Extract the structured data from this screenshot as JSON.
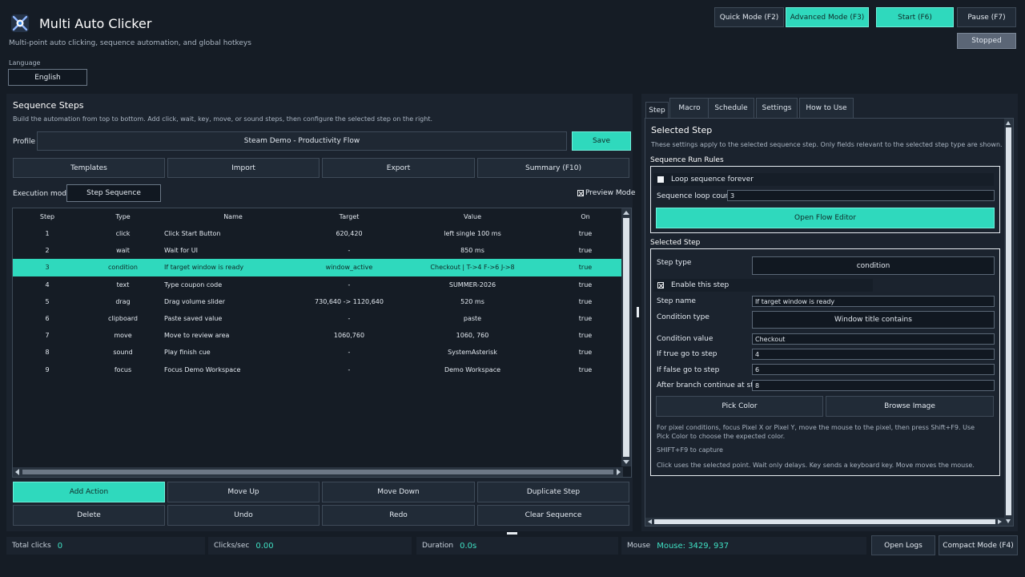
{
  "app": {
    "title": "Multi Auto Clicker",
    "subtitle": "Multi-point auto clicking, sequence automation, and global hotkeys",
    "language_label": "Language",
    "language_value": "English"
  },
  "header": {
    "quick_mode": "Quick Mode (F2)",
    "advanced_mode": "Advanced Mode (F3)",
    "start": "Start (F6)",
    "pause": "Pause (F7)",
    "status": "Stopped"
  },
  "sequence": {
    "title": "Sequence Steps",
    "description": "Build the automation from top to bottom. Add click, wait, key, move, or sound steps, then configure the selected step on the right.",
    "profile_label": "Profile",
    "profile_value": "Steam Demo - Productivity Flow",
    "save": "Save",
    "templates": "Templates",
    "import": "Import",
    "export": "Export",
    "summary": "Summary (F10)",
    "execution_mode_label": "Execution mode",
    "execution_mode_value": "Step Sequence",
    "preview_mode": "Preview Mode",
    "columns": [
      "Step",
      "Type",
      "Name",
      "Target",
      "Value",
      "On"
    ],
    "rows": [
      [
        "1",
        "click",
        "Click Start Button",
        "620,420",
        "left single 100 ms",
        "true"
      ],
      [
        "2",
        "wait",
        "Wait for UI",
        "-",
        "850 ms",
        "true"
      ],
      [
        "3",
        "condition",
        "If target window is ready",
        "window_active",
        "Checkout | T->4 F->6 J->8",
        "true"
      ],
      [
        "4",
        "text",
        "Type coupon code",
        "-",
        "SUMMER-2026",
        "true"
      ],
      [
        "5",
        "drag",
        "Drag volume slider",
        "730,640 -> 1120,640",
        "520 ms",
        "true"
      ],
      [
        "6",
        "clipboard",
        "Paste saved value",
        "-",
        "paste",
        "true"
      ],
      [
        "7",
        "move",
        "Move to review area",
        "1060,760",
        "1060, 760",
        "true"
      ],
      [
        "8",
        "sound",
        "Play finish cue",
        "-",
        "SystemAsterisk",
        "true"
      ],
      [
        "9",
        "focus",
        "Focus Demo Workspace",
        "-",
        "Demo Workspace",
        "true"
      ]
    ],
    "selected_row": 3,
    "actions": {
      "add_action": "Add Action",
      "move_up": "Move Up",
      "move_down": "Move Down",
      "duplicate_step": "Duplicate Step",
      "delete": "Delete",
      "undo": "Undo",
      "redo": "Redo",
      "clear_sequence": "Clear Sequence"
    }
  },
  "tabs": [
    "Step",
    "Macro",
    "Schedule",
    "Settings",
    "How to Use"
  ],
  "step_panel": {
    "title": "Selected Step",
    "description": "These settings apply to the selected sequence step. Only fields relevant to the selected step type are shown.",
    "run_rules_title": "Sequence Run Rules",
    "loop_forever": "Loop sequence forever",
    "loop_count_label": "Sequence loop count",
    "loop_count_value": "3",
    "open_flow_editor": "Open Flow Editor",
    "selected_step_title": "Selected Step",
    "step_type_label": "Step type",
    "step_type_value": "condition",
    "enable_step": "Enable this step",
    "step_name_label": "Step name",
    "step_name_value": "If target window is ready",
    "condition_type_label": "Condition type",
    "condition_type_value": "Window title contains",
    "condition_value_label": "Condition value",
    "condition_value_value": "Checkout",
    "true_goto_label": "If true go to step",
    "true_goto_value": "4",
    "false_goto_label": "If false go to step",
    "false_goto_value": "6",
    "after_branch_label": "After branch continue at step",
    "after_branch_value": "8",
    "pick_color": "Pick Color",
    "browse_image": "Browse Image",
    "help_pixel": "For pixel conditions, focus Pixel X or Pixel Y, move the mouse to the pixel, then press Shift+F9. Use Pick Color to choose the expected color.",
    "capture_hint": "SHIFT+F9 to capture",
    "help_types": "Click uses the selected point. Wait only delays. Key sends a keyboard key. Move moves the mouse."
  },
  "status_bar": {
    "total_clicks_label": "Total clicks",
    "total_clicks_value": "0",
    "clicks_sec_label": "Clicks/sec",
    "clicks_sec_value": "0.00",
    "duration_label": "Duration",
    "duration_value": "0.0s",
    "mouse_label": "Mouse",
    "mouse_value": "Mouse: 3429, 937",
    "open_logs": "Open Logs",
    "compact_mode": "Compact Mode (F4)"
  },
  "colors": {
    "accent": "#2fd9bd",
    "background": "#151c25",
    "panel": "#1b232e"
  }
}
